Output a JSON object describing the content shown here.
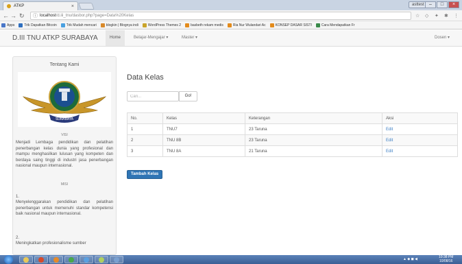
{
  "browser": {
    "tab_title": "ATKP",
    "tab_close": "×",
    "profile": "asttest",
    "url_host": "localhost",
    "url_path": "/d.iii_tnu/dasbor.php?page=Data%20Kelas",
    "bookmarks": [
      {
        "label": "Apps",
        "color": "#4a77c8"
      },
      {
        "label": "Trik Dapatkan Bitcoin",
        "color": "#2f6fbf"
      },
      {
        "label": "Trik Mudah mencari",
        "color": "#4aa0e0"
      },
      {
        "label": "blogkin | Blognya indi",
        "color": "#d98a2b"
      },
      {
        "label": "WordPress Themes 2",
        "color": "#c9a42b"
      },
      {
        "label": "basbeth rekam medis",
        "color": "#e38b1c"
      },
      {
        "label": "Ria Nur Wulandari Ac",
        "color": "#e38b1c"
      },
      {
        "label": "KONSEP DASAR SISTI",
        "color": "#e38b1c"
      },
      {
        "label": "Cara Mendapatkan Fr",
        "color": "#3a8a4a"
      }
    ]
  },
  "navbar": {
    "brand": "D.III TNU ATKP SURABAYA",
    "items": [
      {
        "label": "Home"
      },
      {
        "label": "Belajar-Mengajar ▾"
      },
      {
        "label": "Master ▾"
      }
    ],
    "user": "Dosen ▾"
  },
  "sidebar": {
    "title": "Tentang Kami",
    "logo_text": "SURABAYA",
    "visi_heading": "VISI",
    "visi_text": "Menjadi Lembaga pendidikan dan pelatihan penerbangan kelas dunia yang profesional dan mampu menghasilkan lulusan yang kompeten dan berdaya saing tinggi di industri jasa penerbangan nasional maupun internasional.",
    "misi_heading": "MISI",
    "misi_1_num": "1.",
    "misi_1": "Menyelenggarakan pendidikan dan pelatihan penerbangan untuk memenuhi standar kompetensi baik nasional maupun internasional.",
    "misi_2_num": "2.",
    "misi_2": "Meningkatkan profesionalisme sumber"
  },
  "main": {
    "title": "Data Kelas",
    "search_placeholder": "Cari...",
    "go_label": "Go!",
    "headers": [
      "No.",
      "Kelas",
      "Keterangan",
      "Aksi"
    ],
    "rows": [
      {
        "no": "1",
        "kelas": "TNU7",
        "keterangan": "23 Taruna",
        "aksi": "Edit"
      },
      {
        "no": "2",
        "kelas": "TNU 8B",
        "keterangan": "23 Taruna",
        "aksi": "Edit"
      },
      {
        "no": "3",
        "kelas": "TNU 8A",
        "keterangan": "21 Taruna",
        "aksi": "Edit"
      }
    ],
    "add_button": "Tambah Kelas"
  },
  "taskbar": {
    "time": "10:38 PM",
    "date": "10/08/16"
  },
  "colors": {
    "primary": "#2f75b5",
    "link": "#3b7ec4",
    "tab_bg": "#c9d4e3"
  }
}
